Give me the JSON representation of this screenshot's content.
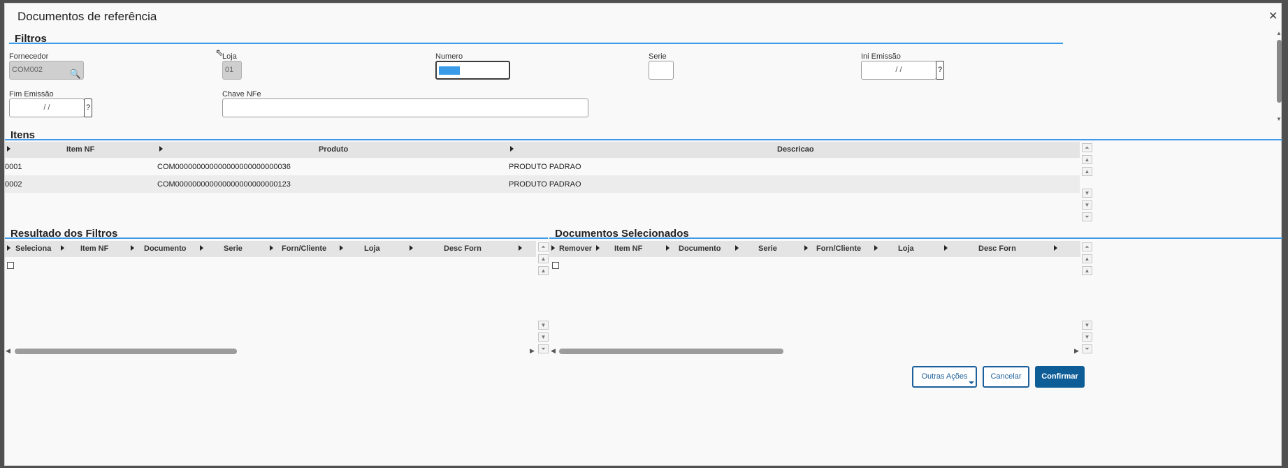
{
  "dialog": {
    "title": "Documentos de referência",
    "close_glyph": "✕"
  },
  "filters": {
    "section_title": "Filtros",
    "fornecedor": {
      "label": "Fornecedor",
      "value": "COM002"
    },
    "loja": {
      "label": "Loja",
      "value": "01"
    },
    "numero": {
      "label": "Numero",
      "value": ""
    },
    "serie": {
      "label": "Serie",
      "value": ""
    },
    "ini_emissao": {
      "label": "Ini Emissão",
      "value": "/ /",
      "help": "?"
    },
    "fim_emissao": {
      "label": "Fim Emissão",
      "value": "/ /",
      "help": "?"
    },
    "chave_nfe": {
      "label": "Chave NFe",
      "value": ""
    }
  },
  "items": {
    "section_title": "Itens",
    "columns": [
      "Item NF",
      "Produto",
      "Descricao"
    ],
    "rows": [
      [
        "0001",
        "COM000000000000000000000000036",
        "PRODUTO PADRAO"
      ],
      [
        "0002",
        "COM000000000000000000000000123",
        "PRODUTO PADRAO"
      ]
    ]
  },
  "results": {
    "section_title": "Resultado dos Filtros",
    "columns": [
      "Seleciona",
      "Item NF",
      "Documento",
      "Serie",
      "Forn/Cliente",
      "Loja",
      "Desc Forn"
    ]
  },
  "selected": {
    "section_title": "Documentos Selecionados",
    "columns": [
      "Remover",
      "Item NF",
      "Documento",
      "Serie",
      "Forn/Cliente",
      "Loja",
      "Desc Forn"
    ]
  },
  "actions": {
    "outras": "Outras Ações",
    "cancelar": "Cancelar",
    "confirmar": "Confirmar"
  },
  "colors": {
    "accent": "#3d9be9",
    "primary": "#0e5d96"
  },
  "icons": {
    "search": "search-icon",
    "close": "close-icon",
    "sort": "sort-triangle-icon"
  }
}
